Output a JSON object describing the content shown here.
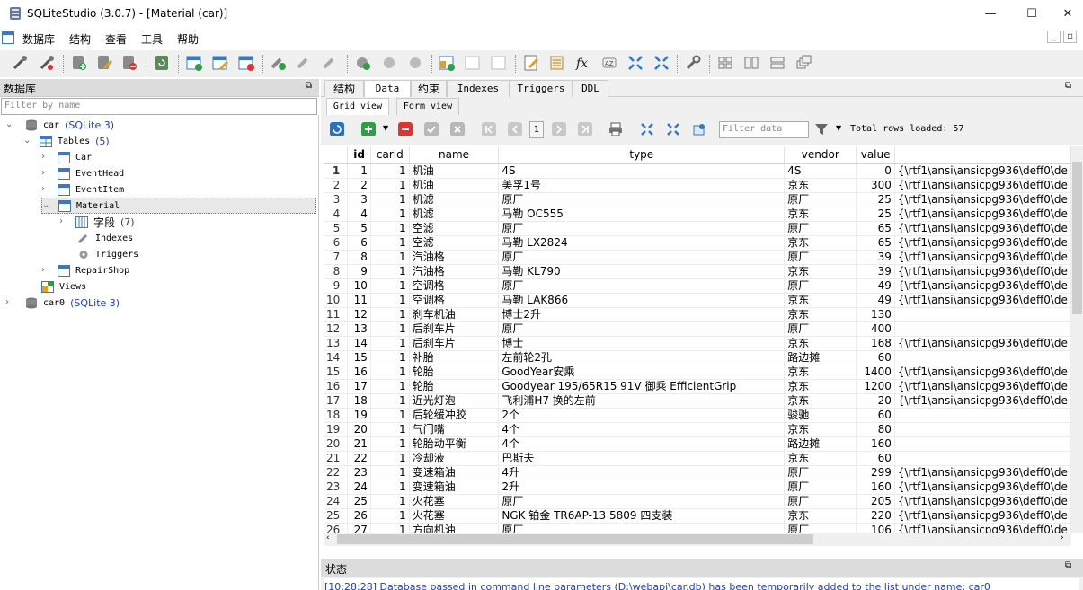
{
  "window": {
    "title": "SQLiteStudio (3.0.7) - [Material (car)]",
    "minimize": "—",
    "maximize": "☐",
    "close": "✕"
  },
  "menubar": {
    "items": [
      "数据库",
      "结构",
      "查看",
      "工具",
      "帮助"
    ]
  },
  "db_panel": {
    "title": "数据库",
    "filter_placeholder": "Filter by name",
    "tree": {
      "db1": {
        "name": "car",
        "engine": "(SQLite 3)"
      },
      "tables": {
        "label": "Tables",
        "count": "(5)"
      },
      "table_names": [
        "Car",
        "EventHead",
        "EventItem",
        "Material",
        "RepairShop"
      ],
      "columns": {
        "label": "字段",
        "count": "(7)"
      },
      "indexes": "Indexes",
      "triggers": "Triggers",
      "views": "Views",
      "db2": {
        "name": "car0",
        "engine": "(SQLite 3)"
      }
    }
  },
  "tabs": [
    "结构",
    "Data",
    "约束",
    "Indexes",
    "Triggers",
    "DDL"
  ],
  "subtabs": [
    "Grid view",
    "Form view"
  ],
  "grid_toolbar": {
    "page": "1",
    "filter_placeholder": "Filter data",
    "rows_loaded": "Total rows loaded: 57"
  },
  "grid": {
    "columns": [
      "id",
      "carid",
      "name",
      "type",
      "vendor",
      "value"
    ],
    "rows": [
      [
        "1",
        "1",
        "1",
        "机油",
        "4S",
        "4S",
        "0",
        "{\\rtf1\\ansi\\ansicpg936\\deff0\\de"
      ],
      [
        "2",
        "2",
        "1",
        "机油",
        "美孚1号",
        "京东",
        "300",
        "{\\rtf1\\ansi\\ansicpg936\\deff0\\de"
      ],
      [
        "3",
        "3",
        "1",
        "机滤",
        "原厂",
        "原厂",
        "25",
        "{\\rtf1\\ansi\\ansicpg936\\deff0\\de"
      ],
      [
        "4",
        "4",
        "1",
        "机滤",
        "马勒 OC555",
        "京东",
        "25",
        "{\\rtf1\\ansi\\ansicpg936\\deff0\\de"
      ],
      [
        "5",
        "5",
        "1",
        "空滤",
        "原厂",
        "原厂",
        "65",
        "{\\rtf1\\ansi\\ansicpg936\\deff0\\de"
      ],
      [
        "6",
        "6",
        "1",
        "空滤",
        "马勒 LX2824",
        "京东",
        "65",
        "{\\rtf1\\ansi\\ansicpg936\\deff0\\de"
      ],
      [
        "7",
        "8",
        "1",
        "汽油格",
        "原厂",
        "原厂",
        "39",
        "{\\rtf1\\ansi\\ansicpg936\\deff0\\de"
      ],
      [
        "8",
        "9",
        "1",
        "汽油格",
        "马勒 KL790",
        "京东",
        "39",
        "{\\rtf1\\ansi\\ansicpg936\\deff0\\de"
      ],
      [
        "9",
        "10",
        "1",
        "空调格",
        "原厂",
        "原厂",
        "49",
        "{\\rtf1\\ansi\\ansicpg936\\deff0\\de"
      ],
      [
        "10",
        "11",
        "1",
        "空调格",
        "马勒 LAK866",
        "京东",
        "49",
        "{\\rtf1\\ansi\\ansicpg936\\deff0\\de"
      ],
      [
        "11",
        "12",
        "1",
        "刹车机油",
        "博士2升",
        "京东",
        "130",
        ""
      ],
      [
        "12",
        "13",
        "1",
        "后刹车片",
        "原厂",
        "原厂",
        "400",
        ""
      ],
      [
        "13",
        "14",
        "1",
        "后刹车片",
        "博士",
        "京东",
        "168",
        "{\\rtf1\\ansi\\ansicpg936\\deff0\\de"
      ],
      [
        "14",
        "15",
        "1",
        "补胎",
        "左前轮2孔",
        "路边摊",
        "60",
        ""
      ],
      [
        "15",
        "16",
        "1",
        "轮胎",
        "GoodYear安乘",
        "京东",
        "1400",
        "{\\rtf1\\ansi\\ansicpg936\\deff0\\de"
      ],
      [
        "16",
        "17",
        "1",
        "轮胎",
        "Goodyear 195/65R15 91V 御乘 EfficientGrip",
        "京东",
        "1200",
        "{\\rtf1\\ansi\\ansicpg936\\deff0\\de"
      ],
      [
        "17",
        "18",
        "1",
        "近光灯泡",
        "飞利浦H7 换的左前",
        "京东",
        "20",
        "{\\rtf1\\ansi\\ansicpg936\\deff0\\de"
      ],
      [
        "18",
        "19",
        "1",
        "后轮缓冲胶",
        "2个",
        "骏驰",
        "60",
        ""
      ],
      [
        "19",
        "20",
        "1",
        "气门嘴",
        "4个",
        "京东",
        "80",
        ""
      ],
      [
        "20",
        "21",
        "1",
        "轮胎动平衡",
        "4个",
        "路边摊",
        "160",
        ""
      ],
      [
        "21",
        "22",
        "1",
        "冷却液",
        "巴斯夫",
        "京东",
        "60",
        ""
      ],
      [
        "22",
        "23",
        "1",
        "变速箱油",
        "4升",
        "原厂",
        "299",
        "{\\rtf1\\ansi\\ansicpg936\\deff0\\de"
      ],
      [
        "23",
        "24",
        "1",
        "变速箱油",
        "2升",
        "原厂",
        "160",
        "{\\rtf1\\ansi\\ansicpg936\\deff0\\de"
      ],
      [
        "24",
        "25",
        "1",
        "火花塞",
        "原厂",
        "原厂",
        "205",
        "{\\rtf1\\ansi\\ansicpg936\\deff0\\de"
      ],
      [
        "25",
        "26",
        "1",
        "火花塞",
        "NGK 铂金 TR6AP-13 5809 四支装",
        "京东",
        "220",
        "{\\rtf1\\ansi\\ansicpg936\\deff0\\de"
      ],
      [
        "26",
        "27",
        "1",
        "方向机油",
        "原厂",
        "原厂",
        "106",
        "{\\rtf1\\ansi\\ansicpg936\\deff0\\de"
      ]
    ]
  },
  "status_panel": {
    "title": "状态",
    "message": "[10:28:28]  Database passed in command line parameters (D:\\webapi\\car.db) has been temporarily added to the list under name: car0"
  }
}
